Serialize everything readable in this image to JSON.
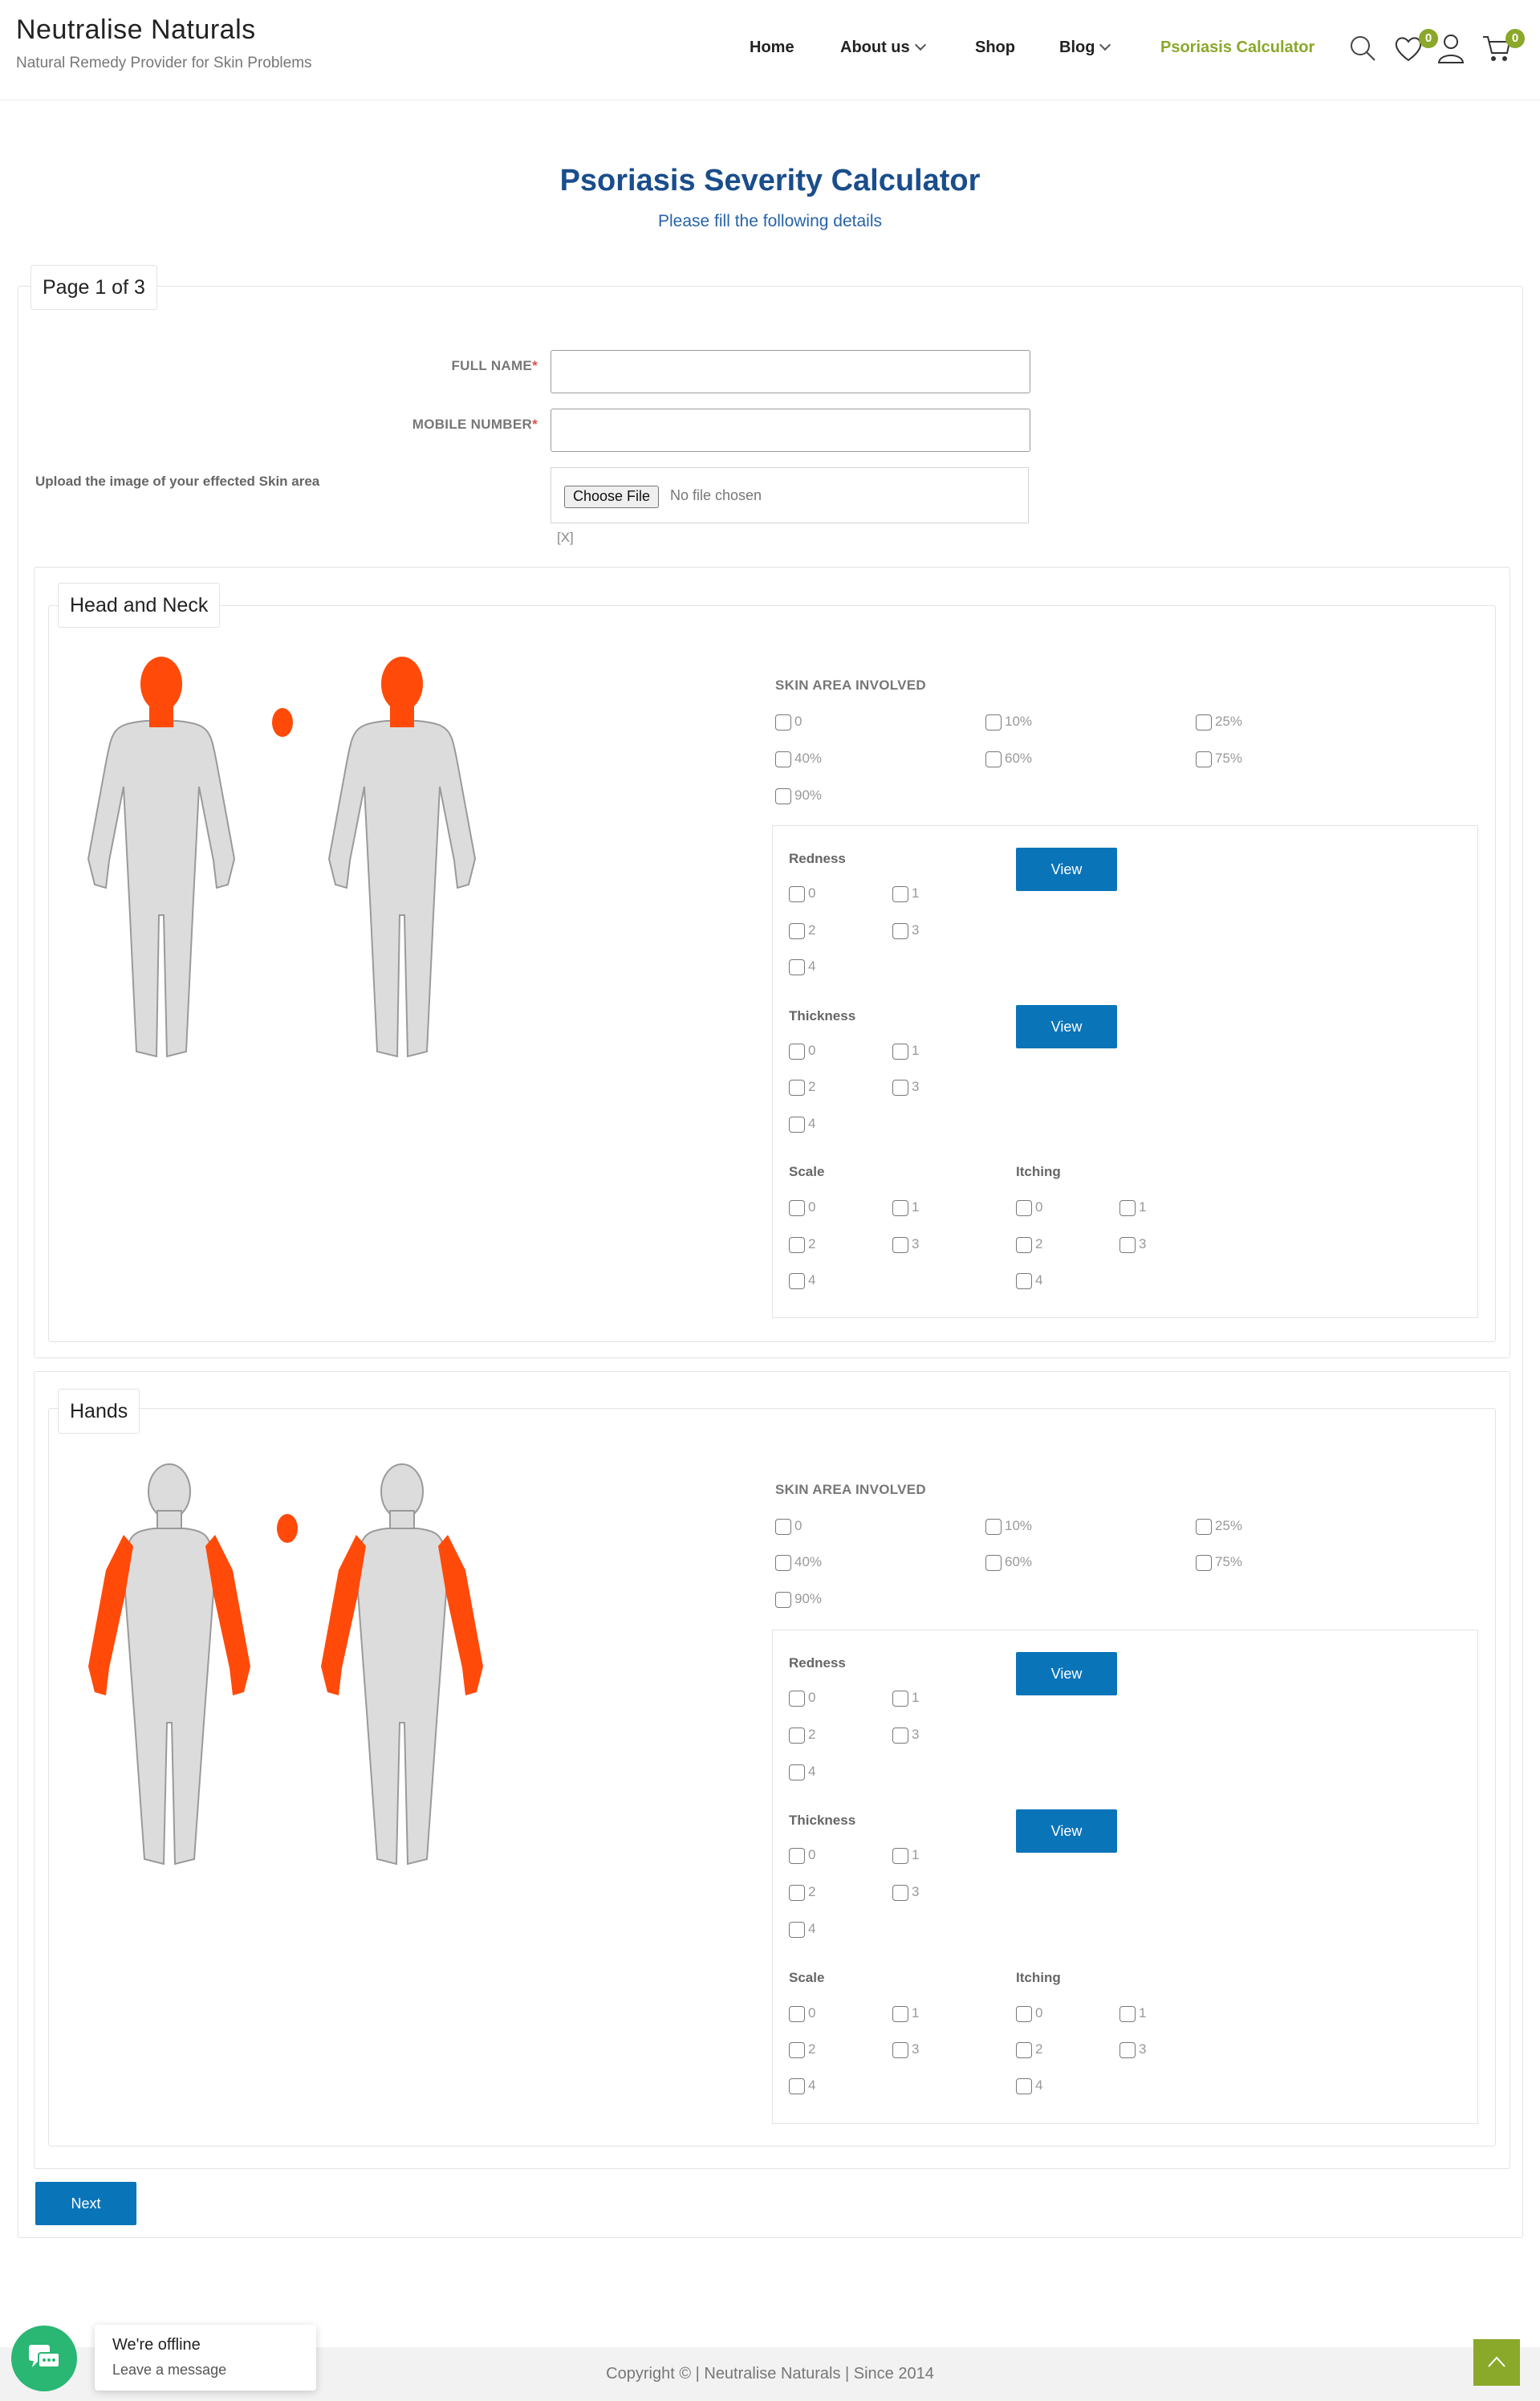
{
  "header": {
    "brand_name": "Neutralise Naturals",
    "brand_tagline": "Natural Remedy Provider for Skin Problems",
    "nav": [
      {
        "label": "Home"
      },
      {
        "label": "About us"
      },
      {
        "label": "Shop"
      },
      {
        "label": "Blog"
      },
      {
        "label": "Psoriasis Calculator"
      }
    ],
    "wishlist_count": "0",
    "cart_count": "0",
    "accent_color": "#8aa829"
  },
  "page": {
    "title": "Psoriasis Severity Calculator",
    "subtitle": "Please fill the following details",
    "page_indicator": "Page 1 of 3"
  },
  "form": {
    "full_name_label": "FULL NAME",
    "full_name_value": "",
    "mobile_label": "MOBILE NUMBER",
    "mobile_value": "",
    "required_mark": "*",
    "upload_label": "Upload the image of your effected Skin area",
    "choose_file_label": "Choose File",
    "no_file_text": "No file chosen",
    "clear_label": "[X]"
  },
  "sections": [
    {
      "title": "Head and Neck",
      "skin_area_label": "SKIN AREA INVOLVED",
      "skin_area_options": [
        "0",
        "10%",
        "25%",
        "40%",
        "60%",
        "75%",
        "90%"
      ],
      "redness_label": "Redness",
      "thickness_label": "Thickness",
      "scale_label": "Scale",
      "itching_label": "Itching",
      "score_options": [
        "0",
        "1",
        "2",
        "3",
        "4"
      ],
      "view_label": "View"
    },
    {
      "title": "Hands",
      "skin_area_label": "SKIN AREA INVOLVED",
      "skin_area_options": [
        "0",
        "10%",
        "25%",
        "40%",
        "60%",
        "75%",
        "90%"
      ],
      "redness_label": "Redness",
      "thickness_label": "Thickness",
      "scale_label": "Scale",
      "itching_label": "Itching",
      "score_options": [
        "0",
        "1",
        "2",
        "3",
        "4"
      ],
      "view_label": "View"
    }
  ],
  "next_label": "Next",
  "footer": {
    "copyright": "Copyright © | Neutralise Naturals | Since 2014"
  },
  "chat": {
    "status": "We're offline",
    "action": "Leave a message",
    "color": "#2ab673"
  },
  "icons": [
    "search-icon",
    "heart-icon",
    "user-icon",
    "cart-icon",
    "chat-icon",
    "arrow-up-icon"
  ]
}
